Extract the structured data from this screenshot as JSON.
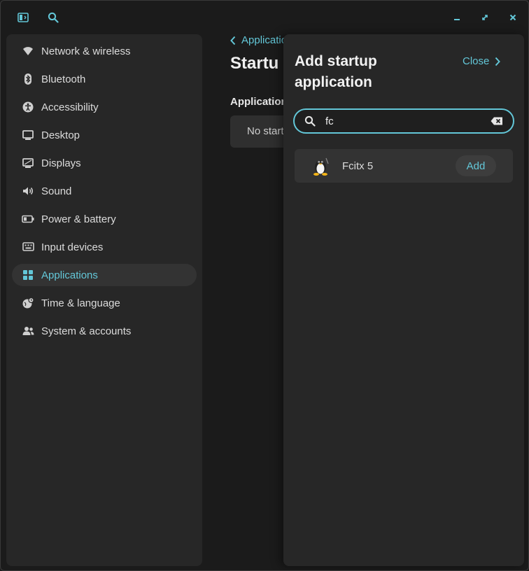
{
  "header": {
    "sidebar_toggle_icon": "sidebar-toggle-icon",
    "search_icon": "search-icon",
    "window_controls": [
      "minimize-icon",
      "maximize-icon",
      "close-icon"
    ]
  },
  "sidebar": {
    "items": [
      {
        "label": "Network & wireless",
        "icon": "wifi-icon"
      },
      {
        "label": "Bluetooth",
        "icon": "bluetooth-icon"
      },
      {
        "label": "Accessibility",
        "icon": "accessibility-icon"
      },
      {
        "label": "Desktop",
        "icon": "desktop-icon"
      },
      {
        "label": "Displays",
        "icon": "display-icon"
      },
      {
        "label": "Sound",
        "icon": "speaker-icon"
      },
      {
        "label": "Power & battery",
        "icon": "battery-icon"
      },
      {
        "label": "Input devices",
        "icon": "keyboard-icon"
      },
      {
        "label": "Applications",
        "icon": "applications-icon",
        "active": true
      },
      {
        "label": "Time & language",
        "icon": "globe-clock-icon"
      },
      {
        "label": "System & accounts",
        "icon": "users-icon"
      }
    ]
  },
  "main": {
    "back_label": "Applicatio",
    "page_title": "Startu",
    "section_title": "Application",
    "empty_text": "No start"
  },
  "dialog": {
    "title": "Add startup application",
    "close_label": "Close",
    "search": {
      "value": "fc",
      "placeholder": ""
    },
    "results": [
      {
        "name": "Fcitx 5",
        "action": "Add",
        "icon": "tux-penguin-icon"
      }
    ]
  },
  "colors": {
    "accent": "#63c7d8",
    "background": "#1b1b1b",
    "panel": "#272727",
    "active_item": "#333333"
  }
}
